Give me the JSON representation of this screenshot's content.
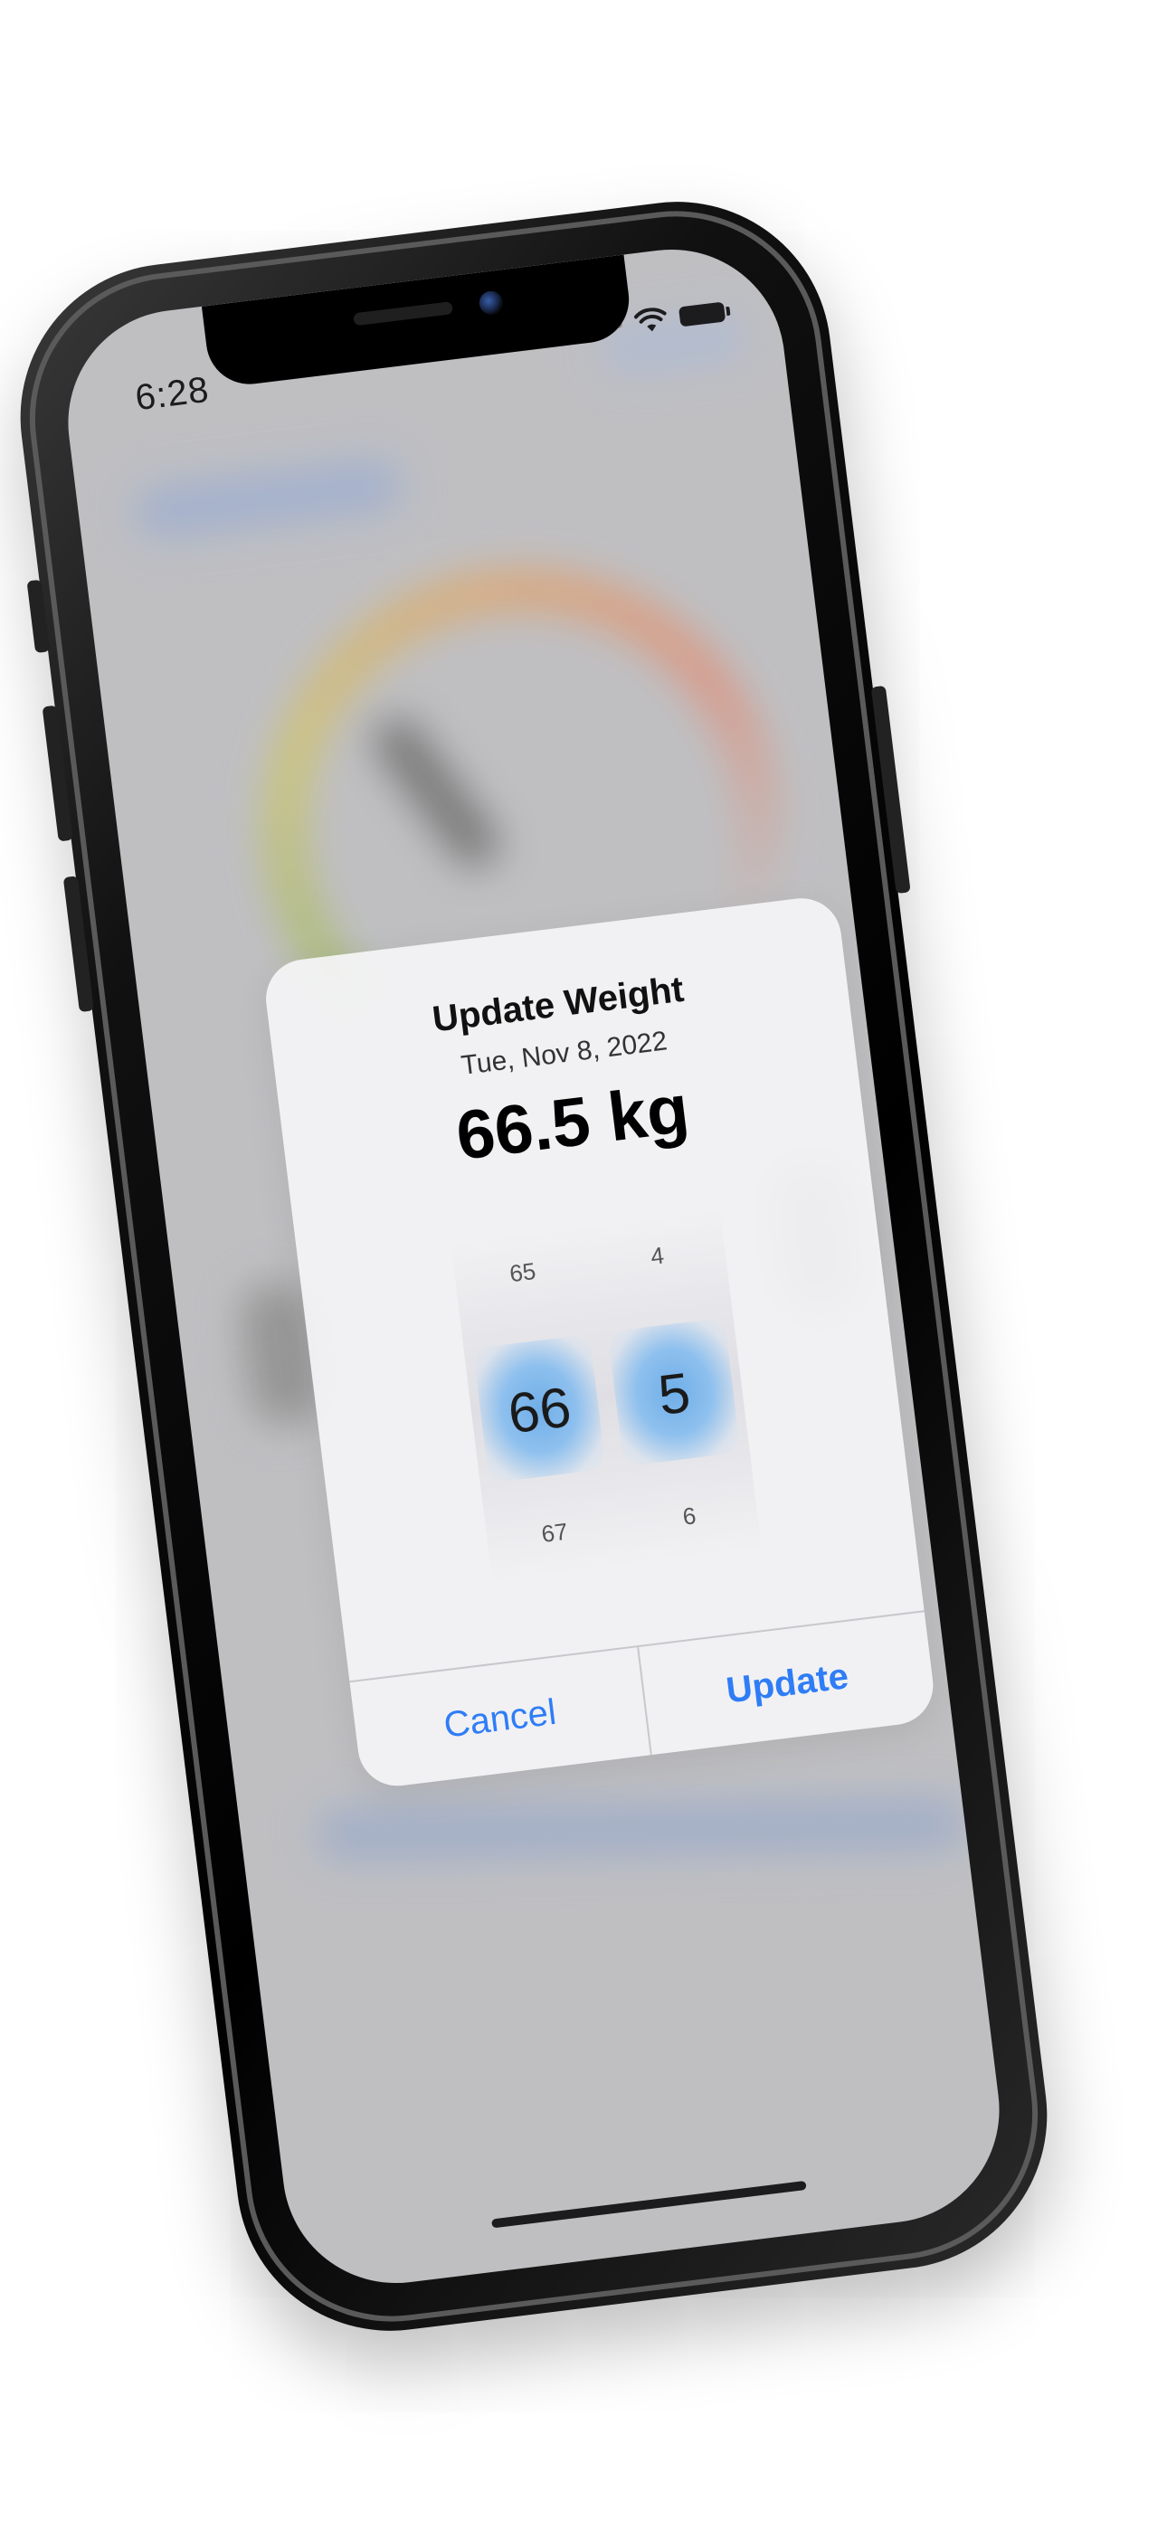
{
  "status_bar": {
    "time": "6:28"
  },
  "dialog": {
    "title": "Update Weight",
    "date": "Tue, Nov 8, 2022",
    "value_display": "66.5 kg",
    "picker": {
      "whole": {
        "above": "65",
        "selected": "66",
        "below": "67"
      },
      "decimal": {
        "above": "4",
        "selected": "5",
        "below": "6"
      }
    },
    "cancel_label": "Cancel",
    "update_label": "Update"
  },
  "colors": {
    "accent": "#2f7df6",
    "picker_highlight": "#6faee8",
    "phone_frame": "#000000"
  },
  "icons": [
    "wifi-icon",
    "battery-icon",
    "cellular-signal-icon"
  ]
}
